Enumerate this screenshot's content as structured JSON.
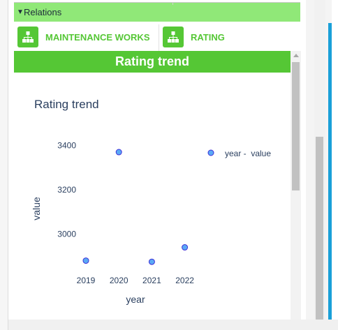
{
  "relations": {
    "toggle_icon": "triangle-down-icon",
    "title": "Relations"
  },
  "tabs": [
    {
      "label": "MAINTENANCE WORKS",
      "icon": "hierarchy-icon"
    },
    {
      "label": "RATING",
      "icon": "hierarchy-icon"
    }
  ],
  "panel_title": "Rating trend",
  "colors": {
    "green": "#55c735",
    "light_green": "#90e878",
    "point_fill": "#5aa9f5",
    "point_stroke": "#3d2fd8",
    "scroll_blue": "#1aa0d8"
  },
  "chart_data": {
    "type": "scatter",
    "title": "Rating trend",
    "xlabel": "year",
    "ylabel": "value",
    "x": [
      2019,
      2020,
      2021,
      2022
    ],
    "y": [
      2880,
      3370,
      2875,
      2940
    ],
    "xticks": [
      "2019",
      "2020",
      "2021",
      "2022"
    ],
    "yticks": [
      3000,
      3200,
      3400
    ],
    "series": [
      {
        "name": "year -  value"
      }
    ],
    "legend": "top-right",
    "grid": false
  }
}
